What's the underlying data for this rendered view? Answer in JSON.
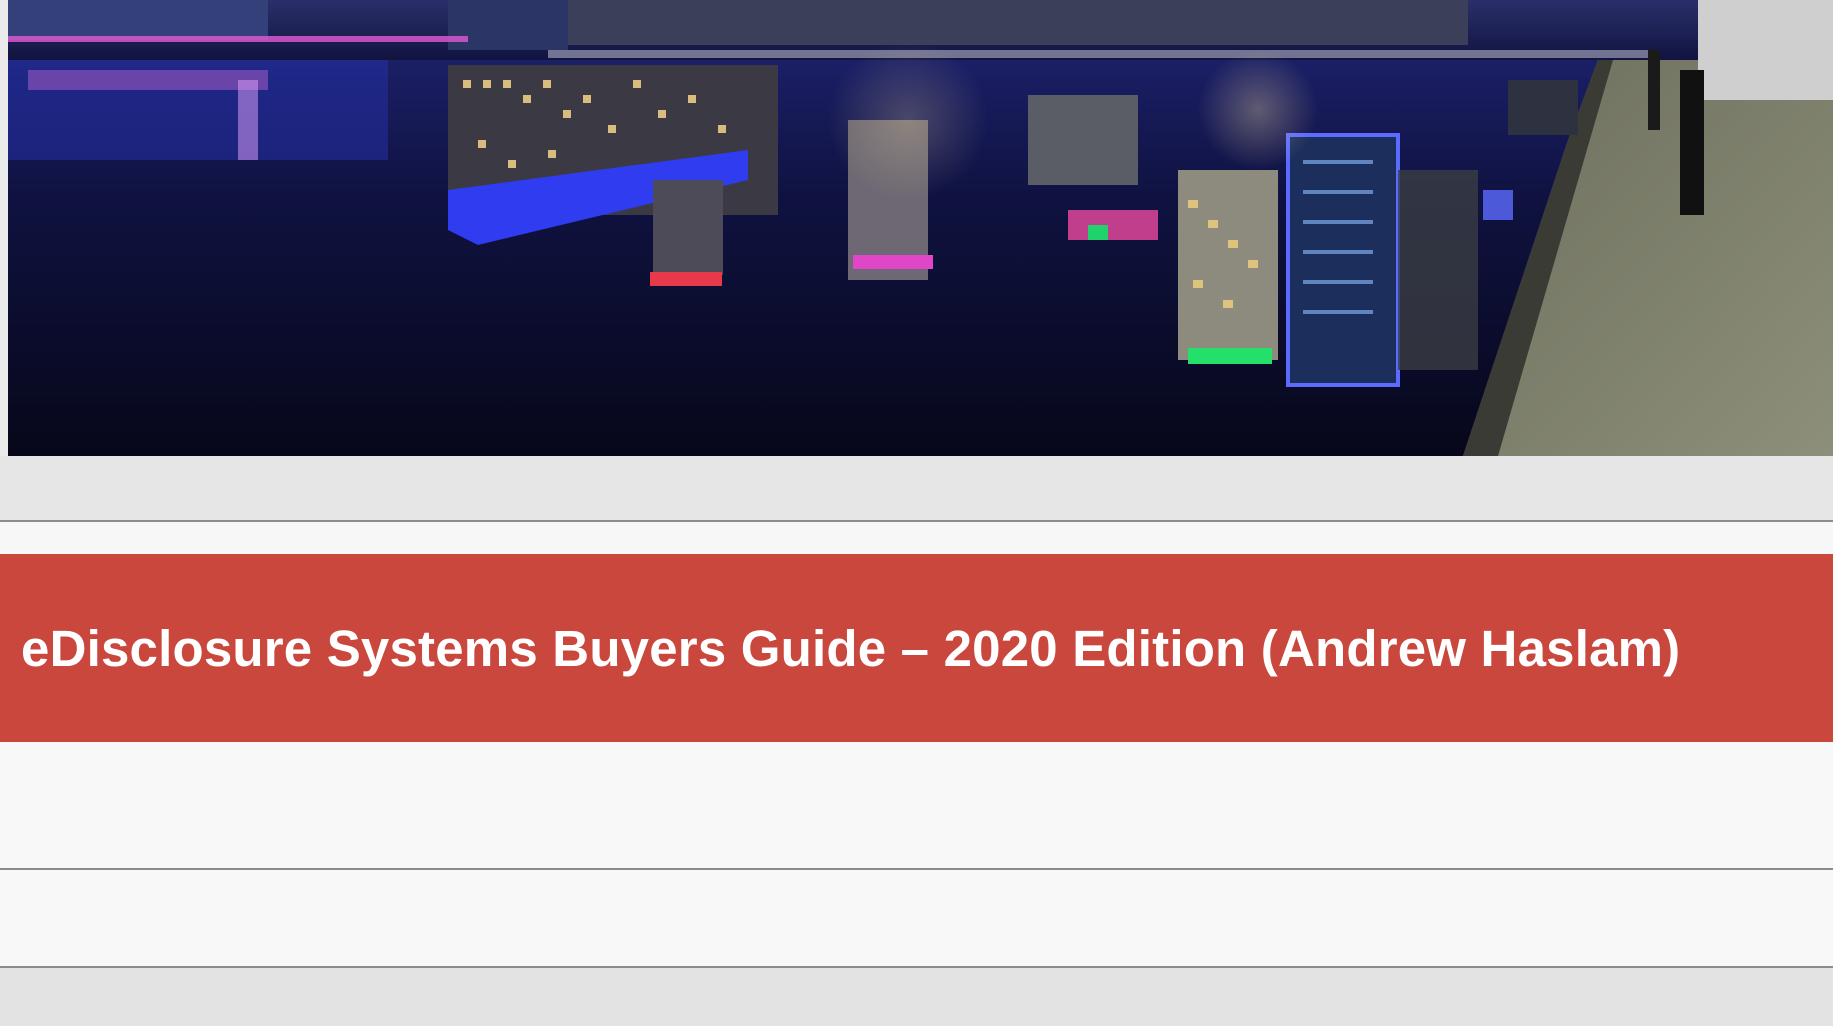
{
  "banner": {
    "title": "eDisclosure Systems Buyers Guide – 2020 Edition (Andrew Haslam)"
  },
  "colors": {
    "banner_background": "#c9473d",
    "banner_text": "#ffffff",
    "page_background": "#ebebeb"
  },
  "hero": {
    "image": "night-waterfront-reflection-photo"
  }
}
